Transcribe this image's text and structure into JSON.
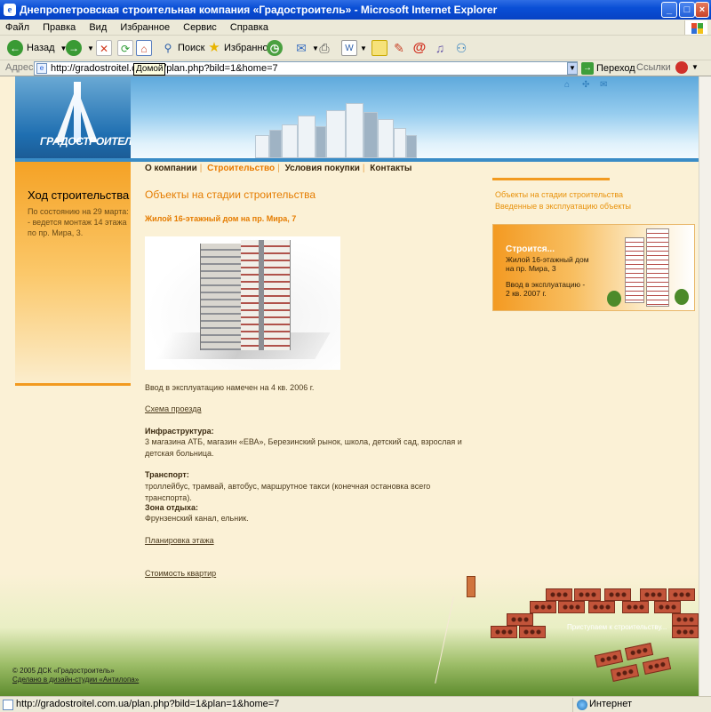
{
  "window": {
    "title": "Днепропетровская строительная компания «Градостроитель» - Microsoft Internet Explorer"
  },
  "menu": [
    "Файл",
    "Правка",
    "Вид",
    "Избранное",
    "Сервис",
    "Справка"
  ],
  "toolbar": {
    "back": "Назад",
    "search": "Поиск",
    "favorites": "Избранное"
  },
  "address": {
    "label": "Адрес:",
    "url": "http://gradostroitel.com.ua/plan.php?bild=1&home=7",
    "tooltip": "Домой",
    "go": "Переход",
    "links": "Ссылки"
  },
  "logo": {
    "text": "ГРАДОСТРОИТЕЛЬ"
  },
  "nav": {
    "items": [
      "О компании",
      "Строительство",
      "Условия покупки",
      "Контакты"
    ],
    "active_index": 1
  },
  "left": {
    "title": "Ход строительства",
    "text": "По состоянию на 29 марта: - ведется монтаж 14 этажа по пр. Мира, 3."
  },
  "main": {
    "title": "Объекты на стадии строительства",
    "subtitle": "Жилой 16-этажный дом на пр. Мира, 7",
    "commission": "Ввод в эксплуатацию намечен на 4 кв. 2006 г.",
    "route_link": "Схема проезда",
    "infra_label": "Инфраструктура:",
    "infra_text": "3 магазина АТБ, магазин «ЕВА», Березинский рынок, школа, детский сад, взрослая и детская больница.",
    "transport_label": "Транспорт:",
    "transport_text": "троллейбус, трамвай, автобус, маршрутное такси (конечная остановка всего транспорта).",
    "rest_label": "Зона отдыха:",
    "rest_text": "Фрунзенский канал, ельник.",
    "plan_link": "Планировка этажа",
    "cost_link": "Стоимость квартир"
  },
  "right": {
    "links": [
      "Объекты на стадии строительства",
      "Введенные в эксплуатацию объекты"
    ],
    "promo": {
      "title": "Строится...",
      "line1": "Жилой 16-этажный дом",
      "line2": "на пр. Мира, 3",
      "line3": "Ввод в эксплуатацию -",
      "line4": "2 кв. 2007 г."
    }
  },
  "bricks": {
    "label": "Приступаем к строительству..."
  },
  "footer": {
    "copyright": "© 2005 ДСК «Градостроитель»",
    "credit": "Сделано в дизайн-студии «Антилопа»"
  },
  "status": {
    "url": "http://gradostroitel.com.ua/plan.php?bild=1&plan=1&home=7",
    "zone": "Интернет"
  }
}
